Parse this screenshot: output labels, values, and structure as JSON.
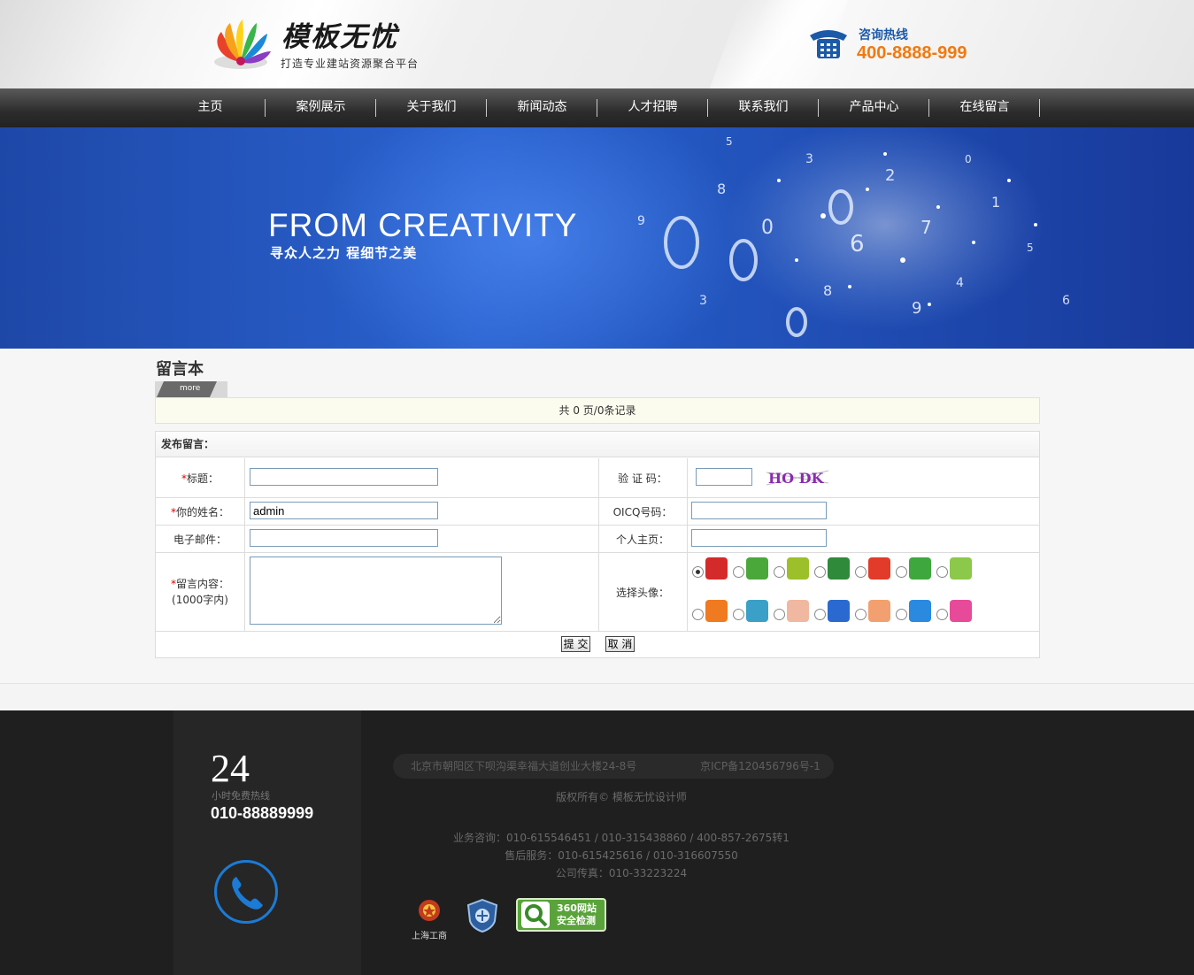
{
  "header": {
    "logo_title": "模板无忧",
    "logo_subtitle": "打造专业建站资源聚合平台",
    "hotline_label": "咨询热线",
    "hotline_number": "400-8888-999"
  },
  "nav": {
    "items": [
      {
        "label": "主页"
      },
      {
        "label": "案例展示"
      },
      {
        "label": "关于我们"
      },
      {
        "label": "新闻动态"
      },
      {
        "label": "人才招聘"
      },
      {
        "label": "联系我们"
      },
      {
        "label": "产品中心"
      },
      {
        "label": "在线留言"
      }
    ]
  },
  "banner": {
    "title": "FROM  CREATIVITY",
    "subtitle": "寻众人之力   程细节之美"
  },
  "guestbook": {
    "page_title": "留言本",
    "more_label": "more",
    "records_text": "共 0 页/0条记录",
    "form_heading": "发布留言：",
    "labels": {
      "title": "标题：",
      "captcha": "验 证 码：",
      "name": "你的姓名：",
      "oicq": "OICQ号码：",
      "email": "电子邮件：",
      "homepage": "个人主页：",
      "content": "留言内容：",
      "content_hint": "(1000字内)",
      "avatar": "选择头像："
    },
    "required_mark": "*",
    "captcha_text": "HO DK",
    "values": {
      "title": "",
      "captcha": "",
      "name": "admin",
      "oicq": "",
      "email": "",
      "homepage": "",
      "content": ""
    },
    "avatars_selected_index": 0,
    "submit_label": "提 交",
    "cancel_label": "取 消"
  },
  "footer": {
    "hours": "24",
    "hours_label": "小时免费热线",
    "phone": "010-88889999",
    "address": "北京市朝阳区下呗沟渠幸福大道创业大楼24-8号",
    "icp": "京ICP备120456796号-1",
    "copyright": "版权所有© 模板无忧设计师",
    "business": "业务咨询：010-615546451 / 010-315438860 / 400-857-2675转1",
    "service": "售后服务：010-615425616 / 010-316607550",
    "fax": "公司传真：010-33223224",
    "badge_police": "上海工商",
    "badge_360": "360网站\n安全检测"
  },
  "colors": {
    "nav_bg": "#2c2c2c",
    "banner_blue": "#2458c2",
    "hotline_orange": "#f07a10",
    "hotline_blue": "#1c5aa8",
    "footer_bg": "#1f1f1f",
    "footer_phone_ring": "#1b7bd6"
  }
}
